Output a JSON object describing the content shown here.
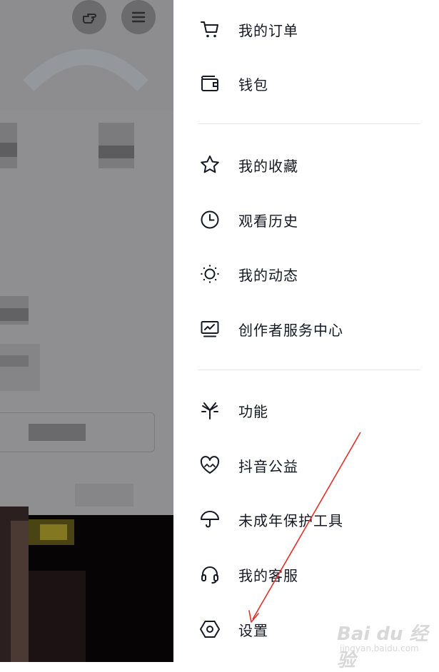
{
  "menu": {
    "items": [
      {
        "label": "我的订单",
        "icon": "cart-icon"
      },
      {
        "label": "钱包",
        "icon": "wallet-icon"
      },
      {
        "label": "我的收藏",
        "icon": "star-icon"
      },
      {
        "label": "观看历史",
        "icon": "clock-icon"
      },
      {
        "label": "我的动态",
        "icon": "sun-icon"
      },
      {
        "label": "创作者服务中心",
        "icon": "chart-monitor-icon"
      },
      {
        "label": "功能",
        "icon": "sparkle-icon"
      },
      {
        "label": "抖音公益",
        "icon": "heart-hands-icon"
      },
      {
        "label": "未成年保护工具",
        "icon": "umbrella-icon"
      },
      {
        "label": "我的客服",
        "icon": "headset-icon"
      },
      {
        "label": "设置",
        "icon": "hexagon-settings-icon"
      }
    ]
  },
  "topbar": {
    "icons": [
      "hand-point-icon",
      "hamburger-menu-icon"
    ]
  },
  "colors": {
    "overlay": "#8d8d8f",
    "text": "#161823",
    "divider": "#e6e6e8",
    "annotation_arrow": "#e0302a"
  },
  "watermark": {
    "main": "Bai du 经验",
    "sub": "jingyan.baidu.com"
  }
}
